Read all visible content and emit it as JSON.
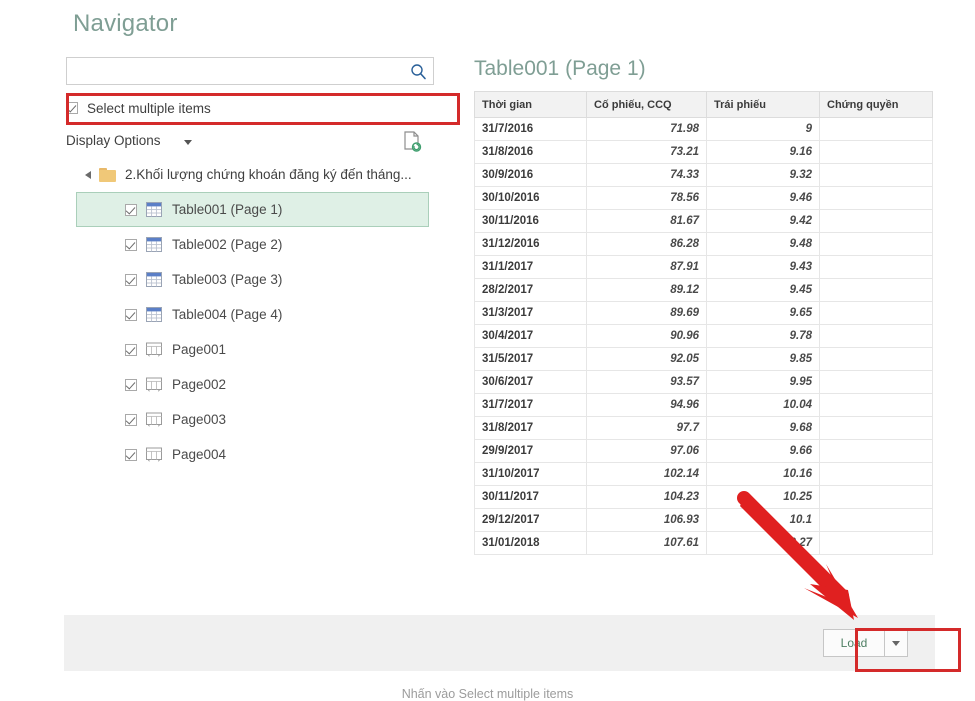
{
  "dialog": {
    "title": "Navigator",
    "search": {
      "value": "",
      "placeholder": "",
      "icon": "search-icon"
    },
    "select_multiple": {
      "label": "Select multiple items",
      "checked": true
    },
    "display_options": {
      "label": "Display Options",
      "caret": "chevron-down-icon",
      "refresh_icon": "refresh-document-icon"
    },
    "tree": {
      "root": {
        "label": "2.Khối lượng chứng khoán đăng ký đến tháng...",
        "icon": "folder-icon",
        "expanded": true
      },
      "items": [
        {
          "label": "Table001 (Page 1)",
          "icon": "table-icon",
          "checked": true,
          "selected": true
        },
        {
          "label": "Table002 (Page 2)",
          "icon": "table-icon",
          "checked": true,
          "selected": false
        },
        {
          "label": "Table003 (Page 3)",
          "icon": "table-icon",
          "checked": true,
          "selected": false
        },
        {
          "label": "Table004 (Page 4)",
          "icon": "table-icon",
          "checked": true,
          "selected": false
        },
        {
          "label": "Page001",
          "icon": "page-icon",
          "checked": true,
          "selected": false
        },
        {
          "label": "Page002",
          "icon": "page-icon",
          "checked": true,
          "selected": false
        },
        {
          "label": "Page003",
          "icon": "page-icon",
          "checked": true,
          "selected": false
        },
        {
          "label": "Page004",
          "icon": "page-icon",
          "checked": true,
          "selected": false
        }
      ]
    },
    "preview": {
      "title": "Table001 (Page 1)",
      "columns": [
        "Thời gian",
        "Cố phiếu, CCQ",
        "Trái phiếu",
        "Chứng quyền"
      ],
      "rows": [
        [
          "31/7/2016",
          "71.98",
          "9",
          ""
        ],
        [
          "31/8/2016",
          "73.21",
          "9.16",
          ""
        ],
        [
          "30/9/2016",
          "74.33",
          "9.32",
          ""
        ],
        [
          "30/10/2016",
          "78.56",
          "9.46",
          ""
        ],
        [
          "30/11/2016",
          "81.67",
          "9.42",
          ""
        ],
        [
          "31/12/2016",
          "86.28",
          "9.48",
          ""
        ],
        [
          "31/1/2017",
          "87.91",
          "9.43",
          ""
        ],
        [
          "28/2/2017",
          "89.12",
          "9.45",
          ""
        ],
        [
          "31/3/2017",
          "89.69",
          "9.65",
          ""
        ],
        [
          "30/4/2017",
          "90.96",
          "9.78",
          ""
        ],
        [
          "31/5/2017",
          "92.05",
          "9.85",
          ""
        ],
        [
          "30/6/2017",
          "93.57",
          "9.95",
          ""
        ],
        [
          "31/7/2017",
          "94.96",
          "10.04",
          ""
        ],
        [
          "31/8/2017",
          "97.7",
          "9.68",
          ""
        ],
        [
          "29/9/2017",
          "97.06",
          "9.66",
          ""
        ],
        [
          "31/10/2017",
          "102.14",
          "10.16",
          ""
        ],
        [
          "30/11/2017",
          "104.23",
          "10.25",
          ""
        ],
        [
          "29/12/2017",
          "106.93",
          "10.1",
          ""
        ],
        [
          "31/01/2018",
          "107.61",
          "10.27",
          ""
        ]
      ]
    },
    "footer": {
      "load_label": "Load",
      "split_caret": "chevron-down-icon"
    }
  },
  "annotations": {
    "highlight_color": "#d42a2a",
    "arrow_color": "#e02020",
    "caption": "Nhấn vào Select multiple items"
  }
}
